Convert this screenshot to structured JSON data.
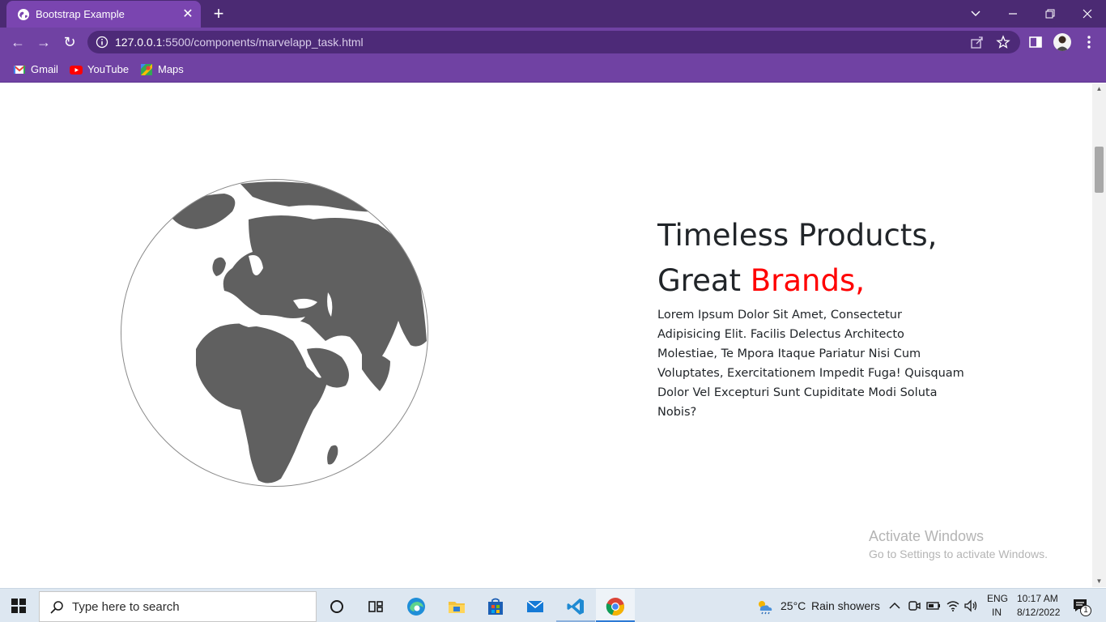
{
  "browser": {
    "tab_title": "Bootstrap Example",
    "tab_close": "✕",
    "new_tab": "+",
    "window_controls": {
      "minimize": "—",
      "restore": "❐",
      "close": "✕",
      "tab_search": "⌄"
    },
    "url_host": "127.0.0.1",
    "url_path": ":5500/components/marvelapp_task.html",
    "nav": {
      "back": "←",
      "forward": "→",
      "reload": "↻"
    },
    "bookmarks": [
      {
        "label": "Gmail",
        "icon": "gmail-icon"
      },
      {
        "label": "YouTube",
        "icon": "youtube-icon"
      },
      {
        "label": "Maps",
        "icon": "maps-icon"
      }
    ]
  },
  "page": {
    "heading_line1": "Timeless Products,",
    "heading_line2_plain": "Great ",
    "heading_line2_accent": "Brands,",
    "paragraph": "Lorem Ipsum Dolor Sit Amet, Consectetur Adipisicing Elit. Facilis Delectus Architecto Molestiae, Te Mpora Itaque Pariatur Nisi Cum Voluptates, Exercitationem Impedit Fuga! Quisquam Dolor Vel Excepturi Sunt Cupiditate Modi Soluta Nobis?",
    "accent_color": "#ff0000",
    "globe_icon": "globe-illustration"
  },
  "watermark": {
    "title": "Activate Windows",
    "subtitle": "Go to Settings to activate Windows."
  },
  "taskbar": {
    "search_placeholder": "Type here to search",
    "weather_temp": "25°C",
    "weather_desc": "Rain showers",
    "lang_line1": "ENG",
    "lang_line2": "IN",
    "time": "10:17 AM",
    "date": "8/12/2022",
    "notification_count": "1",
    "apps": [
      "cortana-icon",
      "task-view-icon",
      "edge-icon",
      "file-explorer-icon",
      "store-icon",
      "mail-icon",
      "vscode-icon",
      "chrome-icon"
    ]
  },
  "colors": {
    "titlebar": "#4b2a73",
    "toolbar": "#7042a3",
    "accent_red": "#ff0000",
    "text_dark": "#212529"
  }
}
